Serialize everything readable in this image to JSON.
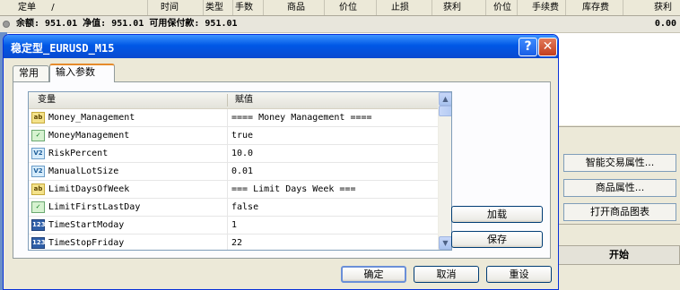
{
  "terminal": {
    "columns": [
      {
        "label": "定单",
        "sort_marker": "/"
      },
      {
        "label": "时间"
      },
      {
        "label": "类型"
      },
      {
        "label": "手数"
      },
      {
        "label": "商品"
      },
      {
        "label": "价位"
      },
      {
        "label": "止损"
      },
      {
        "label": "获利"
      },
      {
        "label": "价位"
      },
      {
        "label": "手续费"
      },
      {
        "label": "库存费"
      },
      {
        "label": "获利"
      }
    ],
    "balance_line": "余额: 951.01  净值: 951.01  可用保付款: 951.01",
    "profit_total": "0.00",
    "right_buttons": [
      "智能交易属性...",
      "商品属性...",
      "打开商品图表"
    ],
    "start_label": "开始"
  },
  "dialog": {
    "title": "稳定型_EURUSD_M15",
    "help_glyph": "?",
    "close_glyph": "✕",
    "tabs": [
      {
        "label": "常用",
        "active": false
      },
      {
        "label": "输入参数",
        "active": true
      }
    ],
    "grid": {
      "headers": {
        "variable": "变量",
        "value": "赋值"
      },
      "rows": [
        {
          "icon": "ab-string-icon",
          "icon_text": "ab",
          "kind": "ab",
          "variable": "Money_Management",
          "value": "==== Money Management ===="
        },
        {
          "icon": "bool-icon",
          "icon_text": "✓",
          "kind": "tf",
          "variable": "MoneyManagement",
          "value": "true"
        },
        {
          "icon": "double-icon",
          "icon_text": "V2",
          "kind": "v2",
          "variable": "RiskPercent",
          "value": "10.0"
        },
        {
          "icon": "double-icon",
          "icon_text": "V2",
          "kind": "v2",
          "variable": "ManualLotSize",
          "value": "0.01"
        },
        {
          "icon": "ab-string-icon",
          "icon_text": "ab",
          "kind": "ab",
          "variable": "LimitDaysOfWeek",
          "value": "=== Limit Days Week ==="
        },
        {
          "icon": "bool-icon",
          "icon_text": "✓",
          "kind": "tf",
          "variable": "LimitFirstLastDay",
          "value": "false"
        },
        {
          "icon": "int-icon",
          "icon_text": "123",
          "kind": "n123",
          "variable": "TimeStartModay",
          "value": "1"
        },
        {
          "icon": "int-icon",
          "icon_text": "123",
          "kind": "n123",
          "variable": "TimeStopFriday",
          "value": "22"
        }
      ],
      "scroll_up_glyph": "▲",
      "scroll_down_glyph": "▼"
    },
    "load_label": "加载",
    "save_label": "保存",
    "ok_label": "确定",
    "cancel_label": "取消",
    "reset_label": "重设"
  }
}
